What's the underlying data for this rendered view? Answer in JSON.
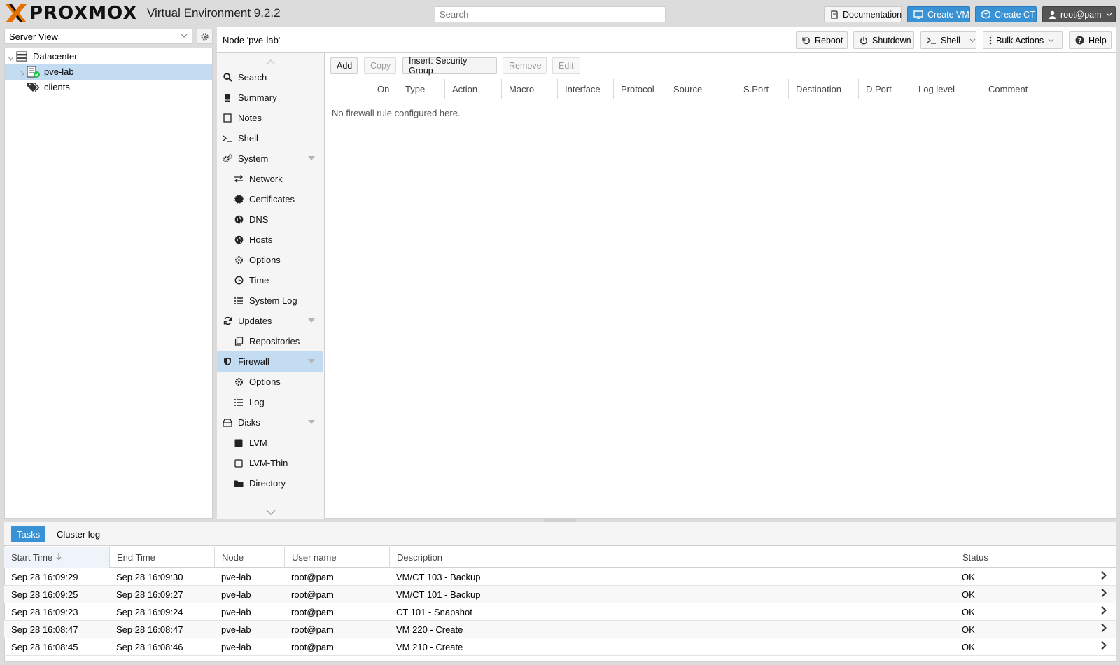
{
  "header": {
    "brand": "PROXMOX",
    "product": "Virtual Environment 9.2.2",
    "search_placeholder": "Search",
    "buttons": {
      "documentation": "Documentation",
      "create_vm": "Create VM",
      "create_ct": "Create CT",
      "user": "root@pam"
    }
  },
  "sidebar": {
    "view": "Server View",
    "tree": [
      {
        "label": "Datacenter",
        "icon": "datacenter-icon"
      },
      {
        "label": "pve-lab",
        "icon": "node-online-icon",
        "selected": true
      },
      {
        "label": "clients",
        "icon": "tags-icon"
      }
    ]
  },
  "node_header": {
    "title": "Node 'pve-lab'",
    "buttons": {
      "reboot": "Reboot",
      "shutdown": "Shutdown",
      "shell": "Shell",
      "bulk_actions": "Bulk Actions",
      "help": "Help"
    }
  },
  "node_menu": {
    "items": [
      {
        "label": "Search",
        "icon": "search-icon"
      },
      {
        "label": "Summary",
        "icon": "book-icon"
      },
      {
        "label": "Notes",
        "icon": "note-icon"
      },
      {
        "label": "Shell",
        "icon": "terminal-icon"
      },
      {
        "label": "System",
        "icon": "cogs-icon",
        "expandable": true
      },
      {
        "label": "Network",
        "icon": "exchange-icon"
      },
      {
        "label": "Certificates",
        "icon": "certificate-icon"
      },
      {
        "label": "DNS",
        "icon": "globe-icon"
      },
      {
        "label": "Hosts",
        "icon": "globe-icon"
      },
      {
        "label": "Options",
        "icon": "gear-icon"
      },
      {
        "label": "Time",
        "icon": "clock-icon"
      },
      {
        "label": "System Log",
        "icon": "list-icon"
      },
      {
        "label": "Updates",
        "icon": "refresh-icon",
        "expandable": true
      },
      {
        "label": "Repositories",
        "icon": "files-icon"
      },
      {
        "label": "Firewall",
        "icon": "shield-icon",
        "expandable": true,
        "selected": true
      },
      {
        "label": "Options",
        "icon": "gear-icon"
      },
      {
        "label": "Log",
        "icon": "list-icon"
      },
      {
        "label": "Disks",
        "icon": "hdd-icon",
        "expandable": true
      },
      {
        "label": "LVM",
        "icon": "square-icon"
      },
      {
        "label": "LVM-Thin",
        "icon": "square-outline-icon"
      },
      {
        "label": "Directory",
        "icon": "folder-icon"
      }
    ]
  },
  "firewall": {
    "toolbar": {
      "add": "Add",
      "copy": "Copy",
      "insert_group": "Insert: Security Group",
      "remove": "Remove",
      "edit": "Edit"
    },
    "columns": [
      "On",
      "Type",
      "Action",
      "Macro",
      "Interface",
      "Protocol",
      "Source",
      "S.Port",
      "Destination",
      "D.Port",
      "Log level",
      "Comment"
    ],
    "empty_text": "No firewall rule configured here."
  },
  "bottom_panel": {
    "tabs": [
      "Tasks",
      "Cluster log"
    ],
    "columns": [
      "Start Time",
      "End Time",
      "Node",
      "User name",
      "Description",
      "Status"
    ],
    "rows": [
      {
        "start": "Sep 28 16:09:29",
        "end": "Sep 28 16:09:30",
        "node": "pve-lab",
        "user": "root@pam",
        "description": "VM/CT 103 - Backup",
        "status": "OK"
      },
      {
        "start": "Sep 28 16:09:25",
        "end": "Sep 28 16:09:27",
        "node": "pve-lab",
        "user": "root@pam",
        "description": "VM/CT 101 - Backup",
        "status": "OK"
      },
      {
        "start": "Sep 28 16:09:23",
        "end": "Sep 28 16:09:24",
        "node": "pve-lab",
        "user": "root@pam",
        "description": "CT 101 - Snapshot",
        "status": "OK"
      },
      {
        "start": "Sep 28 16:08:47",
        "end": "Sep 28 16:08:47",
        "node": "pve-lab",
        "user": "root@pam",
        "description": "VM 220 - Create",
        "status": "OK"
      },
      {
        "start": "Sep 28 16:08:45",
        "end": "Sep 28 16:08:46",
        "node": "pve-lab",
        "user": "root@pam",
        "description": "VM 210 - Create",
        "status": "OK"
      }
    ]
  },
  "colors": {
    "accent": "#3892d4",
    "selection": "#c3dcf2",
    "brand_orange": "#e57000",
    "status_ok": "#21bf4b"
  }
}
